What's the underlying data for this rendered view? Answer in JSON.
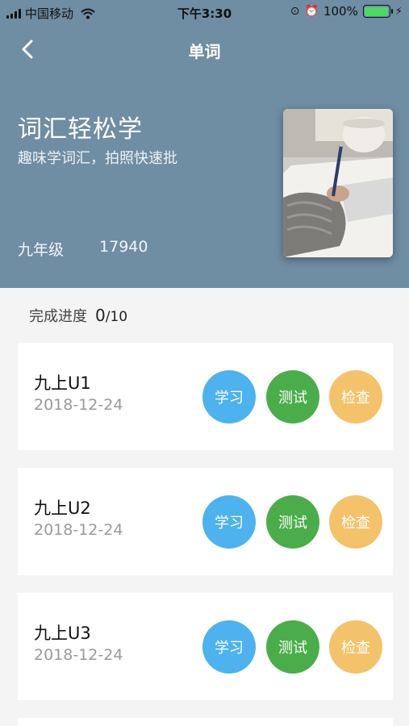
{
  "status_bar": {
    "carrier": "中国移动",
    "time": "下午3:30",
    "battery_percent": "100%"
  },
  "nav": {
    "title": "单词"
  },
  "hero": {
    "title": "词汇轻松学",
    "subtitle": "趣味学词汇，拍照快速批",
    "grade": "九年级",
    "count": "17940"
  },
  "progress": {
    "label": "完成进度",
    "done": "0",
    "total": "/10"
  },
  "units": [
    {
      "name": "九上U1",
      "date": "2018-12-24",
      "study": "学习",
      "test": "测试",
      "check": "检查"
    },
    {
      "name": "九上U2",
      "date": "2018-12-24",
      "study": "学习",
      "test": "测试",
      "check": "检查"
    },
    {
      "name": "九上U3",
      "date": "2018-12-24",
      "study": "学习",
      "test": "测试",
      "check": "检查"
    }
  ],
  "colors": {
    "header_bg": "#6f8da3",
    "study": "#4db2ee",
    "test": "#4aad4a",
    "check": "#f4c26a"
  },
  "icons": [
    "signal-icon",
    "wifi-icon",
    "alarm-icon",
    "battery-icon",
    "back-chevron-icon"
  ]
}
